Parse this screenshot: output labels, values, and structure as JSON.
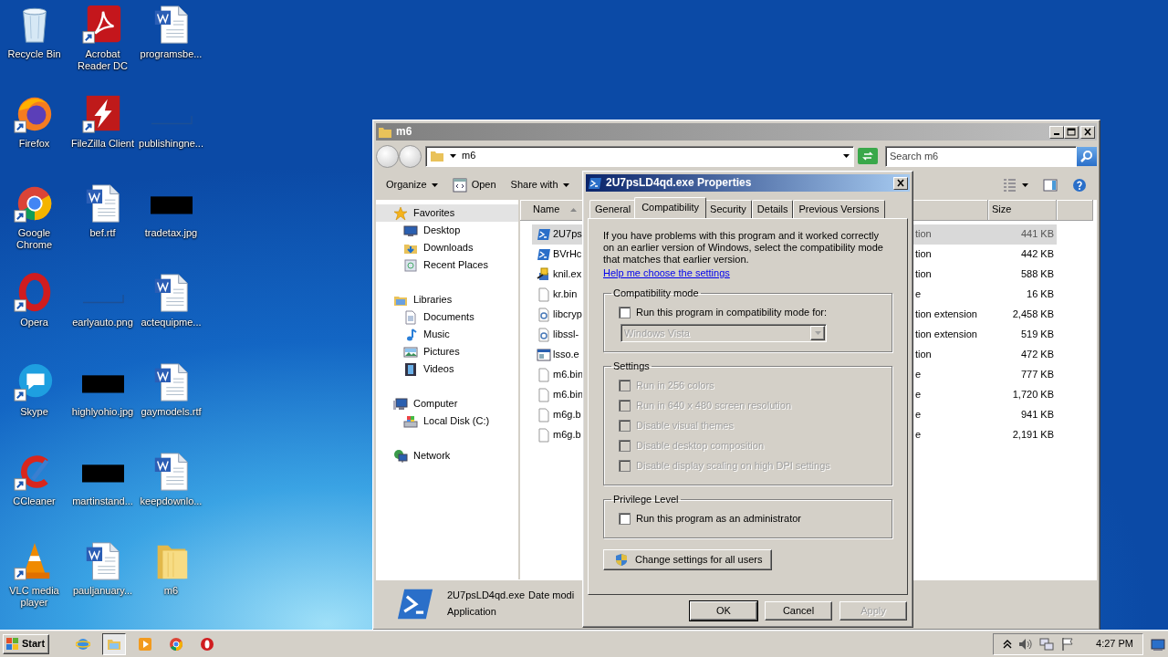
{
  "desktop": {
    "icons": [
      {
        "label": "Recycle Bin",
        "kind": "recycle",
        "shortcut": false
      },
      {
        "label": "Acrobat Reader DC",
        "kind": "acrobat",
        "shortcut": true
      },
      {
        "label": "programsbe...",
        "kind": "document",
        "shortcut": false
      },
      {
        "label": "Firefox",
        "kind": "firefox",
        "shortcut": true
      },
      {
        "label": "FileZilla Client",
        "kind": "filezilla",
        "shortcut": true
      },
      {
        "label": "publishingne...",
        "kind": "image-blank",
        "shortcut": false
      },
      {
        "label": "Google Chrome",
        "kind": "chrome",
        "shortcut": true
      },
      {
        "label": "bef.rtf",
        "kind": "document",
        "shortcut": false
      },
      {
        "label": "tradetax.jpg",
        "kind": "image-dark",
        "shortcut": false
      },
      {
        "label": "Opera",
        "kind": "opera",
        "shortcut": true
      },
      {
        "label": "earlyauto.png",
        "kind": "image-blank",
        "shortcut": false
      },
      {
        "label": "actequipme...",
        "kind": "document",
        "shortcut": false
      },
      {
        "label": "Skype",
        "kind": "skype",
        "shortcut": true
      },
      {
        "label": "highlyohio.jpg",
        "kind": "image-dark",
        "shortcut": false
      },
      {
        "label": "gaymodels.rtf",
        "kind": "document",
        "shortcut": false
      },
      {
        "label": "CCleaner",
        "kind": "ccleaner",
        "shortcut": true
      },
      {
        "label": "martinstand...",
        "kind": "image-dark",
        "shortcut": false
      },
      {
        "label": "keepdownlo...",
        "kind": "document",
        "shortcut": false
      },
      {
        "label": "VLC media player",
        "kind": "vlc",
        "shortcut": true
      },
      {
        "label": "pauljanuary...",
        "kind": "document",
        "shortcut": false
      },
      {
        "label": "m6",
        "kind": "folder",
        "shortcut": false
      }
    ]
  },
  "explorer": {
    "title": "m6",
    "active": false,
    "address": "m6",
    "search_placeholder": "Search m6",
    "toolbar": [
      {
        "label": "Organize",
        "kind": "menu"
      },
      {
        "label": "Open",
        "kind": "open"
      },
      {
        "label": "Share with",
        "kind": "menu"
      }
    ],
    "columns": [
      {
        "label": "Name",
        "sorted": true
      },
      {
        "label": "Size",
        "sorted": false
      }
    ],
    "nav": [
      {
        "label": "Favorites",
        "kind": "star",
        "selected": true,
        "children": [
          {
            "label": "Desktop",
            "kind": "desktop",
            "selected": false
          },
          {
            "label": "Downloads",
            "kind": "downloads",
            "selected": false
          },
          {
            "label": "Recent Places",
            "kind": "recent",
            "selected": false
          }
        ]
      },
      {
        "label": "Libraries",
        "kind": "libraries",
        "selected": false,
        "children": [
          {
            "label": "Documents",
            "kind": "documents",
            "selected": false
          },
          {
            "label": "Music",
            "kind": "music",
            "selected": false
          },
          {
            "label": "Pictures",
            "kind": "pictures",
            "selected": false
          },
          {
            "label": "Videos",
            "kind": "videos",
            "selected": false
          }
        ]
      },
      {
        "label": "Computer",
        "kind": "computer",
        "selected": false,
        "children": [
          {
            "label": "Local Disk (C:)",
            "kind": "disk",
            "selected": false
          }
        ]
      },
      {
        "label": "Network",
        "kind": "network",
        "selected": false
      }
    ],
    "files": [
      {
        "name": "2U7ps",
        "kind": "powershell",
        "type": "tion",
        "size": "441 KB",
        "selected": true
      },
      {
        "name": "BVrHc",
        "kind": "powershell",
        "type": "tion",
        "size": "442 KB",
        "selected": false
      },
      {
        "name": "knil.ex",
        "kind": "setup",
        "type": "tion",
        "size": "588 KB",
        "selected": false
      },
      {
        "name": "kr.bin",
        "kind": "file",
        "type": "e",
        "size": "16 KB",
        "selected": false
      },
      {
        "name": "libcryp",
        "kind": "dll",
        "type": "tion extension",
        "size": "2,458 KB",
        "selected": false
      },
      {
        "name": "libssl-",
        "kind": "dll",
        "type": "tion extension",
        "size": "519 KB",
        "selected": false
      },
      {
        "name": "lsso.e",
        "kind": "window",
        "type": "tion",
        "size": "472 KB",
        "selected": false
      },
      {
        "name": "m6.bin",
        "kind": "file",
        "type": "e",
        "size": "777 KB",
        "selected": false
      },
      {
        "name": "m6.bin",
        "kind": "file",
        "type": "e",
        "size": "1,720 KB",
        "selected": false
      },
      {
        "name": "m6g.b",
        "kind": "file",
        "type": "e",
        "size": "941 KB",
        "selected": false
      },
      {
        "name": "m6g.b",
        "kind": "file",
        "type": "e",
        "size": "2,191 KB",
        "selected": false
      }
    ],
    "details": {
      "name": "2U7psLD4qd.exe",
      "field": "Date modi",
      "type": "Application"
    }
  },
  "dialog": {
    "title": "2U7psLD4qd.exe Properties",
    "active": true,
    "tabs": [
      {
        "label": "General",
        "selected": false
      },
      {
        "label": "Compatibility",
        "selected": true
      },
      {
        "label": "Security",
        "selected": false
      },
      {
        "label": "Details",
        "selected": false
      },
      {
        "label": "Previous Versions",
        "selected": false
      }
    ],
    "intro": "If you have problems with this program and it worked correctly on an earlier version of Windows, select the compatibility mode that matches that earlier version.",
    "help_link": "Help me choose the settings",
    "groups": [
      {
        "title": "Compatibility mode",
        "options": [
          {
            "kind": "checkbox",
            "label": "Run this program in compatibility mode for:",
            "checked": false,
            "disabled": false
          },
          {
            "kind": "dropdown",
            "value": "Windows Vista",
            "disabled": true
          }
        ]
      },
      {
        "title": "Settings",
        "options": [
          {
            "kind": "checkbox",
            "label": "Run in 256 colors",
            "checked": false,
            "disabled": true
          },
          {
            "kind": "checkbox",
            "label": "Run in 640 x 480 screen resolution",
            "checked": false,
            "disabled": true
          },
          {
            "kind": "checkbox",
            "label": "Disable visual themes",
            "checked": false,
            "disabled": true
          },
          {
            "kind": "checkbox",
            "label": "Disable desktop composition",
            "checked": false,
            "disabled": true
          },
          {
            "kind": "checkbox",
            "label": "Disable display scaling on high DPI settings",
            "checked": false,
            "disabled": true
          }
        ]
      },
      {
        "title": "Privilege Level",
        "options": [
          {
            "kind": "checkbox",
            "label": "Run this program as an administrator",
            "checked": false,
            "disabled": false
          }
        ]
      }
    ],
    "all_users_button": "Change settings for all users",
    "buttons": [
      {
        "label": "OK",
        "default": true,
        "disabled": false
      },
      {
        "label": "Cancel",
        "default": false,
        "disabled": false
      },
      {
        "label": "Apply",
        "default": false,
        "disabled": true
      }
    ]
  },
  "taskbar": {
    "start": "Start",
    "apps": [
      {
        "kind": "ie",
        "active": false
      },
      {
        "kind": "explorer",
        "active": true
      },
      {
        "kind": "media",
        "active": false
      },
      {
        "kind": "chrome",
        "active": false
      },
      {
        "kind": "opera",
        "active": false
      }
    ],
    "clock": "4:27 PM"
  }
}
